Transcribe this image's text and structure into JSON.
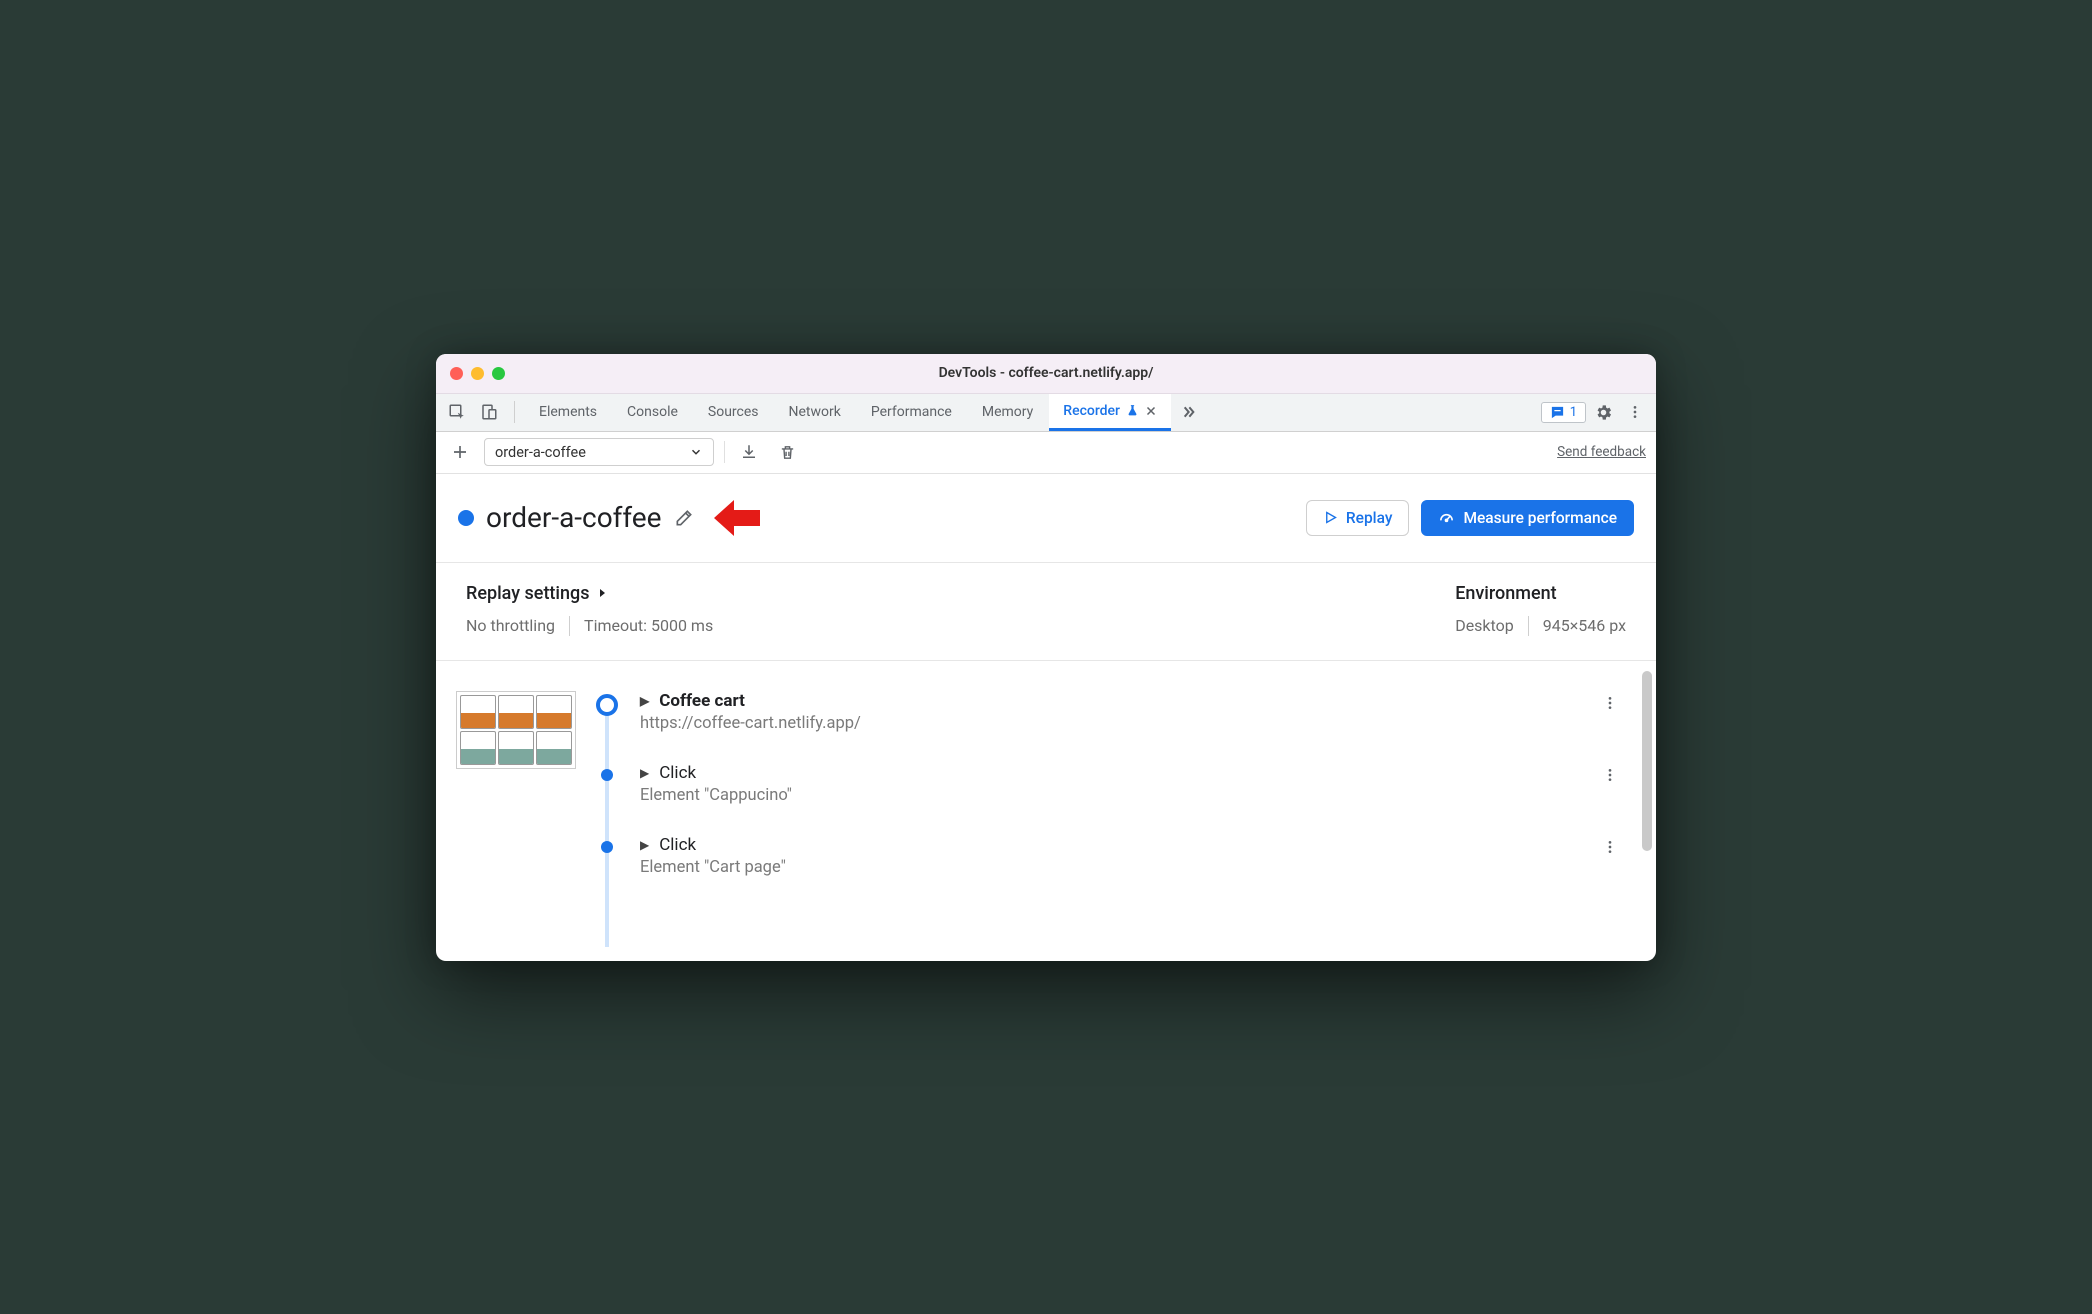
{
  "window": {
    "title": "DevTools - coffee-cart.netlify.app/"
  },
  "tabs": {
    "items": [
      "Elements",
      "Console",
      "Sources",
      "Network",
      "Performance",
      "Memory",
      "Recorder"
    ],
    "active": "Recorder"
  },
  "issues_count": "1",
  "toolbar": {
    "recording_select": "order-a-coffee",
    "feedback": "Send feedback"
  },
  "header": {
    "name": "order-a-coffee",
    "replay_label": "Replay",
    "measure_label": "Measure performance"
  },
  "settings": {
    "replay_heading": "Replay settings",
    "throttling": "No throttling",
    "timeout": "Timeout: 5000 ms",
    "env_heading": "Environment",
    "device": "Desktop",
    "viewport": "945×546 px"
  },
  "steps": [
    {
      "title": "Coffee cart",
      "sub": "https://coffee-cart.netlify.app/",
      "first": true
    },
    {
      "title": "Click",
      "sub": "Element \"Cappucino\"",
      "first": false
    },
    {
      "title": "Click",
      "sub": "Element \"Cart page\"",
      "first": false
    }
  ]
}
